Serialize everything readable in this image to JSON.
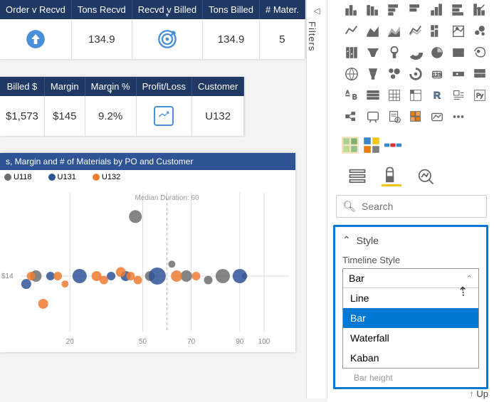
{
  "table1": {
    "headers": [
      "Order v Recvd",
      "Tons Recvd",
      "Recvd v Billed",
      "Tons Billed",
      "# Mater."
    ],
    "row": {
      "col0_icon": "up-arrow",
      "col1": "134.9",
      "col2_icon": "target",
      "col3": "134.9",
      "col4": "5"
    }
  },
  "table2": {
    "headers": [
      "Billed $",
      "Margin",
      "Margin %",
      "Profit/Loss",
      "Customer"
    ],
    "row": {
      "col0": "$1,573",
      "col1": "$145",
      "col2": "9.2%",
      "col3_icon": "trend",
      "col4": "U132"
    }
  },
  "chart": {
    "title": "s, Margin and # of Materials by PO and Customer",
    "legend": [
      {
        "label": "U118",
        "color": "#6e6e6e"
      },
      {
        "label": "U131",
        "color": "#2f5496"
      },
      {
        "label": "U132",
        "color": "#ed7d31"
      }
    ],
    "median_label": "Median Duration: 60",
    "ylabel_tick": "$14",
    "x_ticks": [
      "20",
      "50",
      "70",
      "90",
      "100"
    ]
  },
  "chart_data": {
    "type": "scatter",
    "title": "s, Margin and # of Materials by PO and Customer",
    "xlabel": "",
    "ylabel": "$",
    "xlim": [
      0,
      110
    ],
    "median_x": 60,
    "series": [
      {
        "name": "U118",
        "color": "#6e6e6e",
        "points": [
          {
            "x": 6,
            "y": 14,
            "r": 8
          },
          {
            "x": 47,
            "y": 29,
            "r": 9
          },
          {
            "x": 53,
            "y": 14,
            "r": 7
          },
          {
            "x": 62,
            "y": 17,
            "r": 5
          },
          {
            "x": 68,
            "y": 14,
            "r": 8
          },
          {
            "x": 77,
            "y": 13,
            "r": 6
          },
          {
            "x": 83,
            "y": 14,
            "r": 10
          },
          {
            "x": 92,
            "y": 14,
            "r": 4
          }
        ]
      },
      {
        "name": "U131",
        "color": "#2f5496",
        "points": [
          {
            "x": 2,
            "y": 12,
            "r": 7
          },
          {
            "x": 12,
            "y": 14,
            "r": 6
          },
          {
            "x": 24,
            "y": 14,
            "r": 10
          },
          {
            "x": 37,
            "y": 14,
            "r": 6
          },
          {
            "x": 43,
            "y": 14,
            "r": 7
          },
          {
            "x": 56,
            "y": 14,
            "r": 12
          },
          {
            "x": 90,
            "y": 14,
            "r": 10
          }
        ]
      },
      {
        "name": "U132",
        "color": "#ed7d31",
        "points": [
          {
            "x": 4,
            "y": 14,
            "r": 6
          },
          {
            "x": 9,
            "y": 7,
            "r": 7
          },
          {
            "x": 15,
            "y": 14,
            "r": 6
          },
          {
            "x": 18,
            "y": 12,
            "r": 5
          },
          {
            "x": 31,
            "y": 14,
            "r": 7
          },
          {
            "x": 34,
            "y": 13,
            "r": 6
          },
          {
            "x": 41,
            "y": 15,
            "r": 7
          },
          {
            "x": 45,
            "y": 14,
            "r": 6
          },
          {
            "x": 48,
            "y": 13,
            "r": 6
          },
          {
            "x": 64,
            "y": 14,
            "r": 8
          },
          {
            "x": 72,
            "y": 14,
            "r": 6
          }
        ]
      }
    ]
  },
  "filters_label": "Filters",
  "search": {
    "placeholder": "Search"
  },
  "style_section": {
    "header": "Style",
    "field_label": "Timeline Style",
    "selected": "Bar",
    "options": [
      "Line",
      "Bar",
      "Waterfall",
      "Kaban"
    ],
    "below": "Bar height"
  },
  "up_btn": "Up"
}
